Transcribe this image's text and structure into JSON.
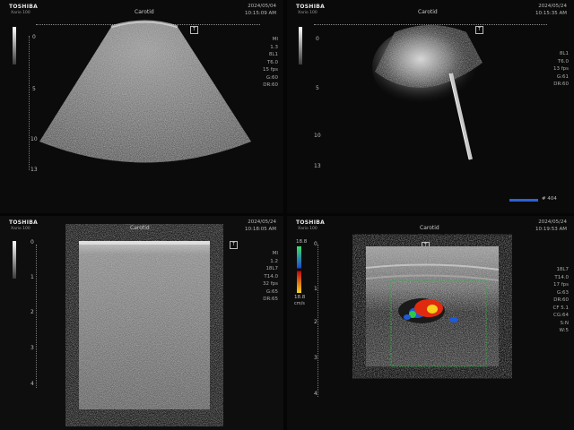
{
  "panels": [
    {
      "brand": "TOSHIBA",
      "model": "Xario 100",
      "preset": "Carotid",
      "date": "2024/05/04",
      "time": "10:15:09 AM",
      "params": [
        "MI",
        "1.3",
        "8L1",
        "T6.0",
        "15 fps",
        "G:60",
        "DR:60"
      ],
      "depth_marks": [
        "0",
        "5",
        "10",
        "13"
      ]
    },
    {
      "brand": "TOSHIBA",
      "model": "Xario 100",
      "preset": "Carotid",
      "date": "2024/05/24",
      "time": "10:15:35 AM",
      "params": [
        "8L1",
        "T6.0",
        "13 fps",
        "G:61",
        "DR:60"
      ],
      "depth_marks": [
        "0",
        "5",
        "10",
        "13"
      ],
      "scale_label": "# 404"
    },
    {
      "brand": "TOSHIBA",
      "model": "Xario 100",
      "preset": "Carotid",
      "date": "2024/05/24",
      "time": "10:18:05 AM",
      "params": [
        "MI",
        "1.2",
        "18L7",
        "T14.0",
        "32 fps",
        "G:65",
        "DR:65"
      ],
      "depth_marks": [
        "0",
        "1",
        "2",
        "3",
        "4"
      ]
    },
    {
      "brand": "TOSHIBA",
      "model": "Xario 100",
      "preset": "Carotid",
      "date": "2024/05/24",
      "time": "10:19:53 AM",
      "params": [
        "18L7",
        "T14.0",
        "17 fps",
        "G:63",
        "DR:60",
        "CF 5.1",
        "CG:64",
        "S:N",
        "W:5"
      ],
      "depth_marks": [
        "0",
        "1",
        "2",
        "3",
        "4"
      ],
      "color_scale": {
        "top": "18.8",
        "bottom": "18.8",
        "unit": "cm/s"
      }
    }
  ],
  "colors": {
    "background": "#050505",
    "flow_red": "#e02a10",
    "flow_blue": "#1f5bd8",
    "flow_yellow": "#f4d01c",
    "flow_green": "#2ec84a",
    "roi_box": "#2cae44"
  }
}
